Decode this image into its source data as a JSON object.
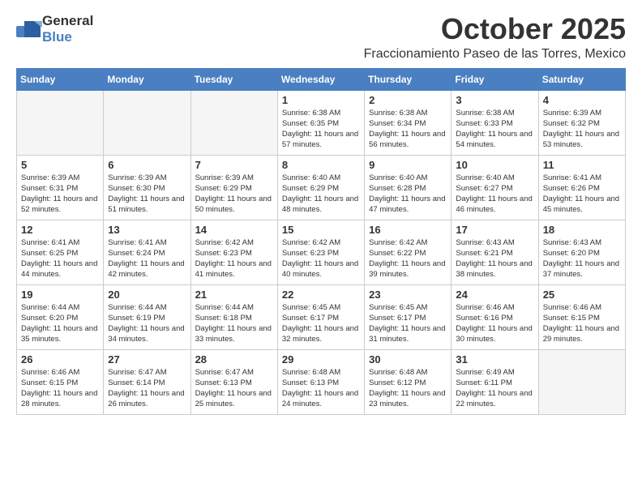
{
  "header": {
    "logo_general": "General",
    "logo_blue": "Blue",
    "month": "October 2025",
    "location": "Fraccionamiento Paseo de las Torres, Mexico"
  },
  "weekdays": [
    "Sunday",
    "Monday",
    "Tuesday",
    "Wednesday",
    "Thursday",
    "Friday",
    "Saturday"
  ],
  "weeks": [
    [
      {
        "day": "",
        "sunrise": "",
        "sunset": "",
        "daylight": ""
      },
      {
        "day": "",
        "sunrise": "",
        "sunset": "",
        "daylight": ""
      },
      {
        "day": "",
        "sunrise": "",
        "sunset": "",
        "daylight": ""
      },
      {
        "day": "1",
        "sunrise": "Sunrise: 6:38 AM",
        "sunset": "Sunset: 6:35 PM",
        "daylight": "Daylight: 11 hours and 57 minutes."
      },
      {
        "day": "2",
        "sunrise": "Sunrise: 6:38 AM",
        "sunset": "Sunset: 6:34 PM",
        "daylight": "Daylight: 11 hours and 56 minutes."
      },
      {
        "day": "3",
        "sunrise": "Sunrise: 6:38 AM",
        "sunset": "Sunset: 6:33 PM",
        "daylight": "Daylight: 11 hours and 54 minutes."
      },
      {
        "day": "4",
        "sunrise": "Sunrise: 6:39 AM",
        "sunset": "Sunset: 6:32 PM",
        "daylight": "Daylight: 11 hours and 53 minutes."
      }
    ],
    [
      {
        "day": "5",
        "sunrise": "Sunrise: 6:39 AM",
        "sunset": "Sunset: 6:31 PM",
        "daylight": "Daylight: 11 hours and 52 minutes."
      },
      {
        "day": "6",
        "sunrise": "Sunrise: 6:39 AM",
        "sunset": "Sunset: 6:30 PM",
        "daylight": "Daylight: 11 hours and 51 minutes."
      },
      {
        "day": "7",
        "sunrise": "Sunrise: 6:39 AM",
        "sunset": "Sunset: 6:29 PM",
        "daylight": "Daylight: 11 hours and 50 minutes."
      },
      {
        "day": "8",
        "sunrise": "Sunrise: 6:40 AM",
        "sunset": "Sunset: 6:29 PM",
        "daylight": "Daylight: 11 hours and 48 minutes."
      },
      {
        "day": "9",
        "sunrise": "Sunrise: 6:40 AM",
        "sunset": "Sunset: 6:28 PM",
        "daylight": "Daylight: 11 hours and 47 minutes."
      },
      {
        "day": "10",
        "sunrise": "Sunrise: 6:40 AM",
        "sunset": "Sunset: 6:27 PM",
        "daylight": "Daylight: 11 hours and 46 minutes."
      },
      {
        "day": "11",
        "sunrise": "Sunrise: 6:41 AM",
        "sunset": "Sunset: 6:26 PM",
        "daylight": "Daylight: 11 hours and 45 minutes."
      }
    ],
    [
      {
        "day": "12",
        "sunrise": "Sunrise: 6:41 AM",
        "sunset": "Sunset: 6:25 PM",
        "daylight": "Daylight: 11 hours and 44 minutes."
      },
      {
        "day": "13",
        "sunrise": "Sunrise: 6:41 AM",
        "sunset": "Sunset: 6:24 PM",
        "daylight": "Daylight: 11 hours and 42 minutes."
      },
      {
        "day": "14",
        "sunrise": "Sunrise: 6:42 AM",
        "sunset": "Sunset: 6:23 PM",
        "daylight": "Daylight: 11 hours and 41 minutes."
      },
      {
        "day": "15",
        "sunrise": "Sunrise: 6:42 AM",
        "sunset": "Sunset: 6:23 PM",
        "daylight": "Daylight: 11 hours and 40 minutes."
      },
      {
        "day": "16",
        "sunrise": "Sunrise: 6:42 AM",
        "sunset": "Sunset: 6:22 PM",
        "daylight": "Daylight: 11 hours and 39 minutes."
      },
      {
        "day": "17",
        "sunrise": "Sunrise: 6:43 AM",
        "sunset": "Sunset: 6:21 PM",
        "daylight": "Daylight: 11 hours and 38 minutes."
      },
      {
        "day": "18",
        "sunrise": "Sunrise: 6:43 AM",
        "sunset": "Sunset: 6:20 PM",
        "daylight": "Daylight: 11 hours and 37 minutes."
      }
    ],
    [
      {
        "day": "19",
        "sunrise": "Sunrise: 6:44 AM",
        "sunset": "Sunset: 6:20 PM",
        "daylight": "Daylight: 11 hours and 35 minutes."
      },
      {
        "day": "20",
        "sunrise": "Sunrise: 6:44 AM",
        "sunset": "Sunset: 6:19 PM",
        "daylight": "Daylight: 11 hours and 34 minutes."
      },
      {
        "day": "21",
        "sunrise": "Sunrise: 6:44 AM",
        "sunset": "Sunset: 6:18 PM",
        "daylight": "Daylight: 11 hours and 33 minutes."
      },
      {
        "day": "22",
        "sunrise": "Sunrise: 6:45 AM",
        "sunset": "Sunset: 6:17 PM",
        "daylight": "Daylight: 11 hours and 32 minutes."
      },
      {
        "day": "23",
        "sunrise": "Sunrise: 6:45 AM",
        "sunset": "Sunset: 6:17 PM",
        "daylight": "Daylight: 11 hours and 31 minutes."
      },
      {
        "day": "24",
        "sunrise": "Sunrise: 6:46 AM",
        "sunset": "Sunset: 6:16 PM",
        "daylight": "Daylight: 11 hours and 30 minutes."
      },
      {
        "day": "25",
        "sunrise": "Sunrise: 6:46 AM",
        "sunset": "Sunset: 6:15 PM",
        "daylight": "Daylight: 11 hours and 29 minutes."
      }
    ],
    [
      {
        "day": "26",
        "sunrise": "Sunrise: 6:46 AM",
        "sunset": "Sunset: 6:15 PM",
        "daylight": "Daylight: 11 hours and 28 minutes."
      },
      {
        "day": "27",
        "sunrise": "Sunrise: 6:47 AM",
        "sunset": "Sunset: 6:14 PM",
        "daylight": "Daylight: 11 hours and 26 minutes."
      },
      {
        "day": "28",
        "sunrise": "Sunrise: 6:47 AM",
        "sunset": "Sunset: 6:13 PM",
        "daylight": "Daylight: 11 hours and 25 minutes."
      },
      {
        "day": "29",
        "sunrise": "Sunrise: 6:48 AM",
        "sunset": "Sunset: 6:13 PM",
        "daylight": "Daylight: 11 hours and 24 minutes."
      },
      {
        "day": "30",
        "sunrise": "Sunrise: 6:48 AM",
        "sunset": "Sunset: 6:12 PM",
        "daylight": "Daylight: 11 hours and 23 minutes."
      },
      {
        "day": "31",
        "sunrise": "Sunrise: 6:49 AM",
        "sunset": "Sunset: 6:11 PM",
        "daylight": "Daylight: 11 hours and 22 minutes."
      },
      {
        "day": "",
        "sunrise": "",
        "sunset": "",
        "daylight": ""
      }
    ]
  ]
}
